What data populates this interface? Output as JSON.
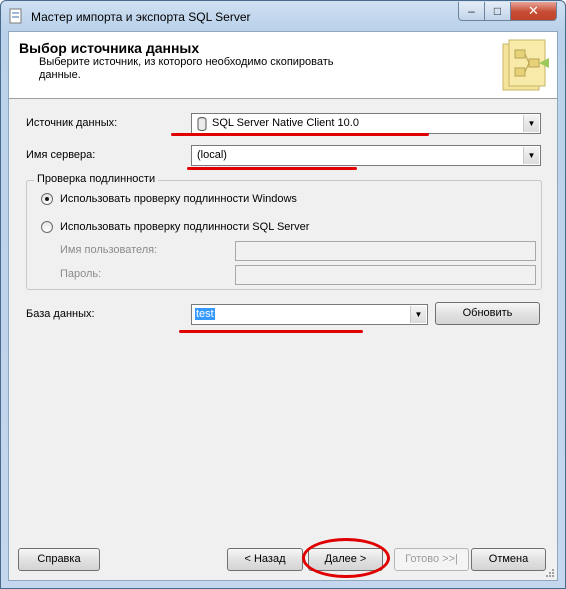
{
  "window": {
    "title": "Мастер импорта и экспорта SQL Server",
    "controls": {
      "minimize": "–",
      "maximize": "□",
      "close": "✕"
    }
  },
  "header": {
    "title": "Выбор источника данных",
    "subtitle": "Выберите источник, из которого необходимо скопировать данные.",
    "icon": "wizard-source-icon"
  },
  "form": {
    "source_label": "Источник данных:",
    "source_value": "SQL Server Native Client 10.0",
    "server_label": "Имя сервера:",
    "server_value": "(local)",
    "auth": {
      "group_title": "Проверка подлинности",
      "windows_label": "Использовать проверку подлинности Windows",
      "windows_checked": true,
      "sql_label": "Использовать проверку подлинности SQL Server",
      "sql_checked": false,
      "user_label": "Имя пользователя:",
      "user_value": "",
      "password_label": "Пароль:",
      "password_value": ""
    },
    "database_label": "База данных:",
    "database_value": "test",
    "refresh_button": "Обновить"
  },
  "footer": {
    "help_button": "Справка",
    "back_button": "< Назад",
    "next_button": "Далее >",
    "finish_button": "Готово >>|",
    "cancel_button": "Отмена"
  },
  "annotations": {
    "marker_color": "#e00000"
  },
  "colors": {
    "selection": "#3399ff",
    "close_button": "#c74b33"
  }
}
